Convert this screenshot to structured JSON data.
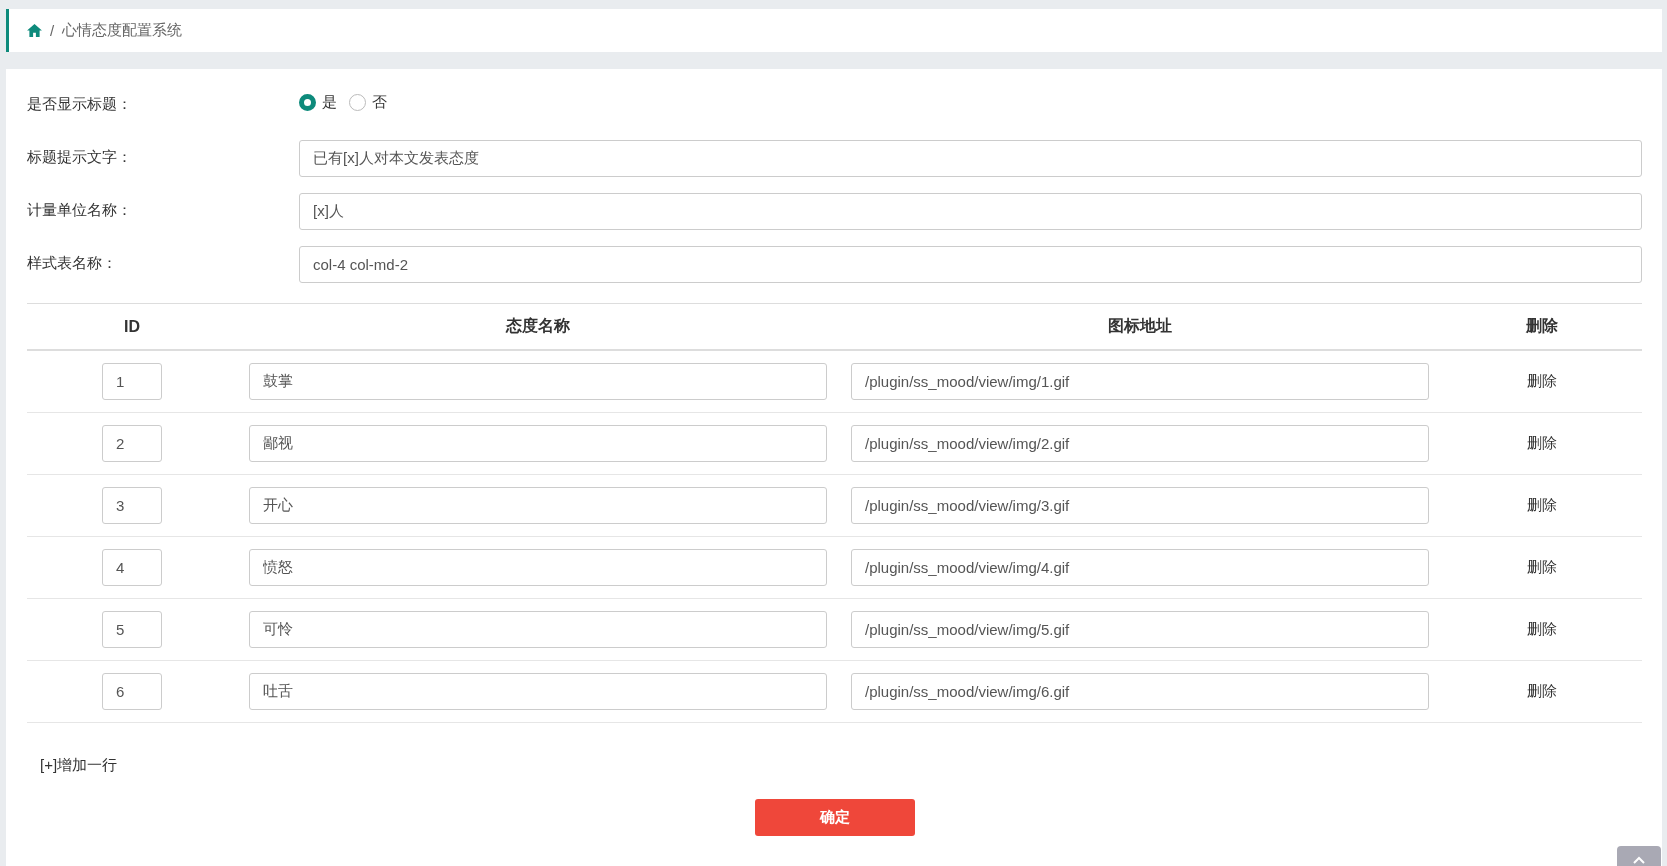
{
  "breadcrumb": {
    "separator": "/",
    "title": "心情态度配置系统"
  },
  "settings": [
    {
      "kind": "radio",
      "label": "是否显示标题：",
      "options": [
        {
          "label": "是",
          "selected": true
        },
        {
          "label": "否",
          "selected": false
        }
      ]
    },
    {
      "kind": "text",
      "label": "标题提示文字：",
      "value": "已有[x]人对本文发表态度"
    },
    {
      "kind": "text",
      "label": "计量单位名称：",
      "value": "[x]人"
    },
    {
      "kind": "text",
      "label": "样式表名称：",
      "value": "col-4 col-md-2"
    }
  ],
  "table": {
    "columns": [
      "ID",
      "态度名称",
      "图标地址",
      "删除"
    ],
    "rows": [
      {
        "id": "1",
        "name": "鼓掌",
        "icon": "/plugin/ss_mood/view/img/1.gif",
        "action": "删除"
      },
      {
        "id": "2",
        "name": "鄙视",
        "icon": "/plugin/ss_mood/view/img/2.gif",
        "action": "删除"
      },
      {
        "id": "3",
        "name": "开心",
        "icon": "/plugin/ss_mood/view/img/3.gif",
        "action": "删除"
      },
      {
        "id": "4",
        "name": "愤怒",
        "icon": "/plugin/ss_mood/view/img/4.gif",
        "action": "删除"
      },
      {
        "id": "5",
        "name": "可怜",
        "icon": "/plugin/ss_mood/view/img/5.gif",
        "action": "删除"
      },
      {
        "id": "6",
        "name": "吐舌",
        "icon": "/plugin/ss_mood/view/img/6.gif",
        "action": "删除"
      }
    ]
  },
  "add_row": "[+]增加一行",
  "submit": "确定"
}
